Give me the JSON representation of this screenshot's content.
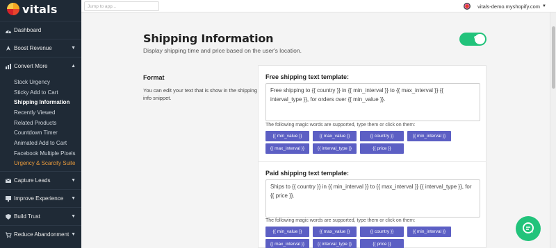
{
  "brand": {
    "name": "vitals"
  },
  "topbar": {
    "search_placeholder": "Jump to app...",
    "shop": "vitals-demo.myshopify.com"
  },
  "sidebar": {
    "items": [
      {
        "label": "Dashboard",
        "icon": "dashboard-icon",
        "has_chevron": false
      },
      {
        "label": "Boost Revenue",
        "icon": "rocket-icon",
        "has_chevron": true
      },
      {
        "label": "Convert More",
        "icon": "chart-icon",
        "has_chevron": true,
        "expanded": true
      },
      {
        "label": "Capture Leads",
        "icon": "mail-icon",
        "has_chevron": true
      },
      {
        "label": "Improve Experience",
        "icon": "monitor-icon",
        "has_chevron": true
      },
      {
        "label": "Build Trust",
        "icon": "shield-icon",
        "has_chevron": true
      },
      {
        "label": "Reduce Abandonment",
        "icon": "cart-icon",
        "has_chevron": true
      }
    ],
    "sub_items": [
      {
        "label": "Stock Urgency"
      },
      {
        "label": "Sticky Add to Cart"
      },
      {
        "label": "Shipping Information",
        "active": true
      },
      {
        "label": "Recently Viewed"
      },
      {
        "label": "Related Products"
      },
      {
        "label": "Countdown Timer"
      },
      {
        "label": "Animated Add to Cart"
      },
      {
        "label": "Facebook Multiple Pixels"
      },
      {
        "label": "Urgency & Scarcity Suite",
        "highlight": true
      }
    ]
  },
  "main": {
    "title": "Shipping Information",
    "subtitle": "Display shipping time and price based on the user's location.",
    "toggle": {
      "label": "ON",
      "state": true
    },
    "format": {
      "title": "Format",
      "description": "You can edit your text that is show in the shipping info snippet."
    },
    "free": {
      "title": "Free shipping text template:",
      "value": "Free shipping to {{ country }} in {{ min_interval }} to {{ max_interval }} {{ interval_type }}, for orders over {{ min_value }}.",
      "hint": "The following magic words are supported, type them or click on them:",
      "tags": [
        "{{ min_value }}",
        "{{ max_value }}",
        "{{ country }}",
        "{{ min_interval }}",
        "{{ max_interval }}",
        "{{ interval_type }}",
        "{{ price }}"
      ]
    },
    "paid": {
      "title": "Paid shipping text template:",
      "value": "Ships to {{ country }} in {{ min_interval }}  to {{ max_interval }} {{ interval_type }}, for {{ price }}.",
      "hint": "The following magic words are supported, type them or click on them:",
      "tags": [
        "{{ min_value }}",
        "{{ max_value }}",
        "{{ country }}",
        "{{ min_interval }}",
        "{{ max_interval }}",
        "{{ interval_type }}",
        "{{ price }}"
      ]
    }
  },
  "colors": {
    "sidebar": "#1f2a36",
    "accent": "#5c5fc4",
    "toggle": "#22c37b",
    "highlight": "#e89a3c"
  }
}
